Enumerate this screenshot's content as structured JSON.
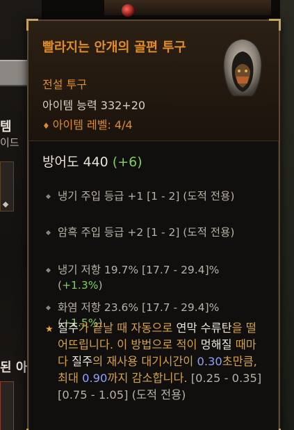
{
  "background": {
    "left_fragment_1": "템",
    "left_fragment_2": "이드",
    "left_fragment_3": "된 아"
  },
  "item": {
    "title": "빨라지는 안개의 골편 투구",
    "rarity": "전설 투구",
    "item_power": "아이템 능력 332+20",
    "item_level": "아이템 레벨: 4/4",
    "icon": "hood-helmet-icon"
  },
  "armor": {
    "label": "방어도 440",
    "bonus": "(+6)"
  },
  "affixes": [
    {
      "text": "냉기 주입 등급 +1 [1 - 2] (도적 전용)"
    },
    {
      "text": "암흑 주입 등급 +2 [1 - 2] (도적 전용)"
    },
    {
      "text": "냉기 저항 19.7% [17.7 - 29.4]% (",
      "bonus": "+1.3%",
      "suffix": ")"
    },
    {
      "text": "화염 저항 23.6% [17.7 - 29.4]% (",
      "bonus": "+1.5%",
      "suffix": ")"
    }
  ],
  "aspect": {
    "p1": "질주",
    "p2": "가 끝날 때 자동으로 ",
    "p3": "연막 수류탄",
    "p4": "을 떨어뜨립니다. 이 방법으로 적이 ",
    "p5": "멍해질",
    "p6": " 때마다 ",
    "p7": "질주",
    "p8": "의 재사용 대기시간이 ",
    "p9": "0.30",
    "p10": "초만큼, 최대 ",
    "p11": "0.90",
    "p12": "까지 감소합니다. ",
    "p13": "[0.25 - 0.35][0.75 - 1.05] (도적 전용)"
  },
  "colors": {
    "legendary": "#e08c2b",
    "bonus_green": "#7fcf5a",
    "value_blue": "#8ea2ff"
  }
}
